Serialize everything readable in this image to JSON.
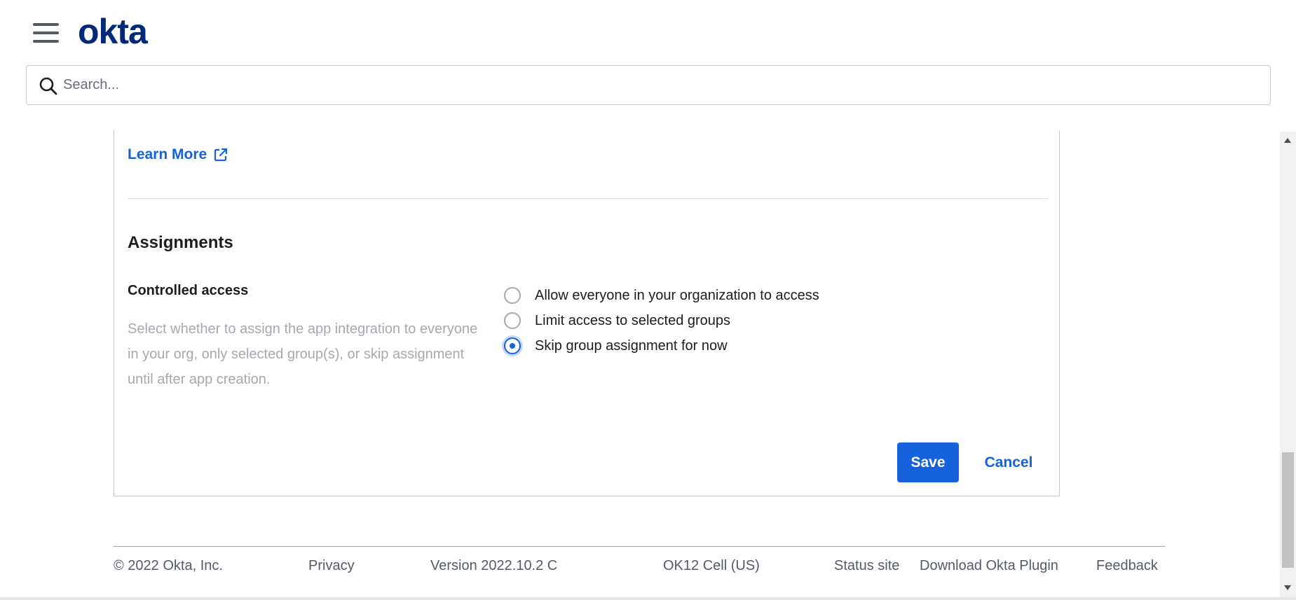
{
  "header": {
    "logo_text": "okta",
    "search": {
      "placeholder": "Search...",
      "value": ""
    }
  },
  "panel": {
    "learn_more_label": "Learn More",
    "section_title": "Assignments",
    "field_label": "Controlled access",
    "field_help": "Select whether to assign the app integration to everyone in your org, only selected group(s), or skip assignment until after app creation.",
    "options": [
      {
        "label": "Allow everyone in your organization to access",
        "checked": false
      },
      {
        "label": "Limit access to selected groups",
        "checked": false
      },
      {
        "label": "Skip group assignment for now",
        "checked": true
      }
    ],
    "save_label": "Save",
    "cancel_label": "Cancel"
  },
  "footer": {
    "copyright": "© 2022 Okta, Inc.",
    "privacy": "Privacy",
    "version": "Version 2022.10.2 C",
    "cell": "OK12 Cell (US)",
    "status_site": "Status site",
    "download_plugin": "Download Okta Plugin",
    "feedback": "Feedback"
  },
  "colors": {
    "brand": "#00297a",
    "accent": "#1662dd",
    "muted_text": "#a7a9b0",
    "border": "#c7c9cf"
  }
}
